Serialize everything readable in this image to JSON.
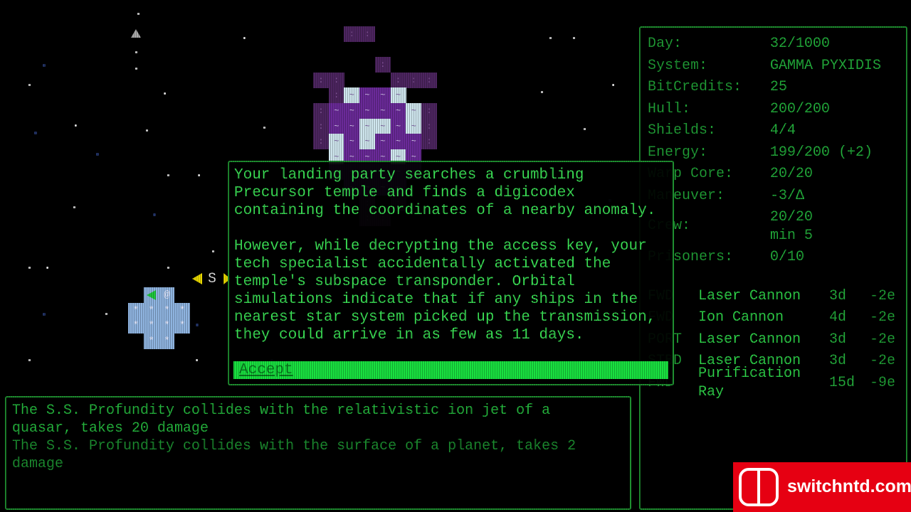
{
  "stats": [
    {
      "label": "Day:",
      "value": "32/1000"
    },
    {
      "label": "System:",
      "value": "GAMMA PYXIDIS"
    },
    {
      "label": "BitCredits:",
      "value": "25"
    },
    {
      "label": "Hull:",
      "value": "200/200"
    },
    {
      "label": "Shields:",
      "value": "4/4"
    },
    {
      "label": "Energy:",
      "value": "199/200 (+2)"
    },
    {
      "label": "Warp Core:",
      "value": "20/20"
    },
    {
      "label": "Maneuver:",
      "value": "-3/Δ"
    },
    {
      "label": "Crew:",
      "value": "20/20",
      "value2": "min 5"
    },
    {
      "label": "Prisoners:",
      "value": "0/10"
    }
  ],
  "weapons": [
    {
      "slot": "FWD",
      "name": "Laser Cannon",
      "damage": "3d",
      "energy": "-2e"
    },
    {
      "slot": "FWD",
      "name": "Ion Cannon",
      "damage": "4d",
      "energy": "-2e"
    },
    {
      "slot": "PORT",
      "name": "Laser Cannon",
      "damage": "3d",
      "energy": "-2e"
    },
    {
      "slot": "STBD",
      "name": "Laser Cannon",
      "damage": "3d",
      "energy": "-2e"
    },
    {
      "slot": "FWD",
      "name": "Purification",
      "name2": "Ray",
      "damage": "15d",
      "energy": "-9e"
    }
  ],
  "dialog": {
    "text": "Your landing party searches a crumbling\nPrecursor temple and finds a digicodex\ncontaining the coordinates of a nearby anomaly.\n\nHowever, while decrypting the access key, your\ntech specialist accidentally activated the\ntemple's subspace transponder. Orbital\nsimulations indicate that if any ships in the\nnearest star system picked up the transmission,\nthey could arrive in as few as 11 days.",
    "accept_label": "Accept"
  },
  "log": [
    {
      "text": "The S.S. Profundity collides with the relativistic ion jet of a\nquasar, takes 20 damage"
    },
    {
      "text": "The S.S. Profundity collides with the surface of a planet, takes 2\ndamage"
    }
  ],
  "map": {
    "ship_glyph": "@",
    "star_marker": "S",
    "planet_glyph": "~"
  },
  "watermark": {
    "text": "switchntd.com"
  },
  "colors": {
    "text_green": "#2fd64a",
    "accept_bg": "#19e040",
    "planet_purple": "#6a2a98",
    "ship_blue": "#8fb4e0",
    "marker_yellow": "#e8d800"
  }
}
